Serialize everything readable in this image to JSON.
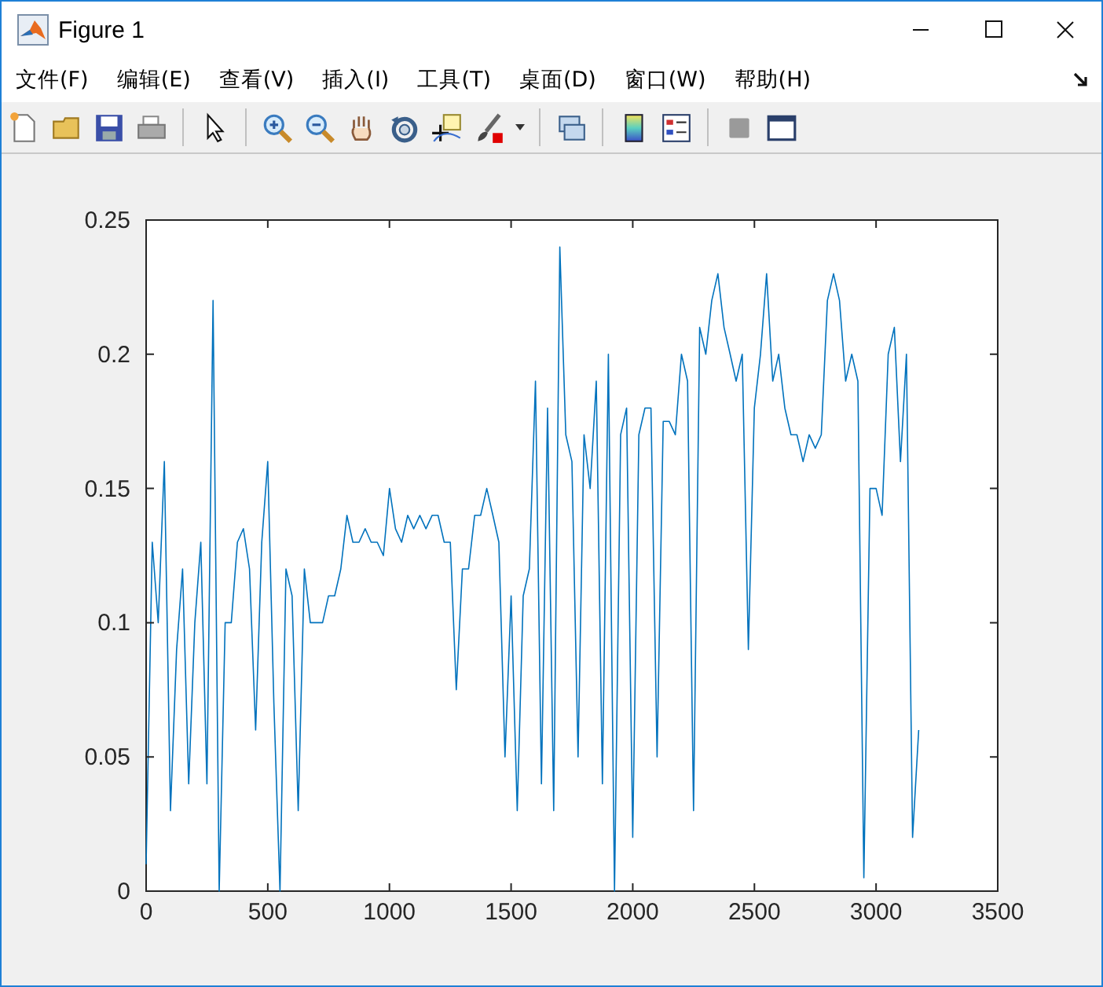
{
  "window": {
    "title": "Figure 1"
  },
  "menu": [
    {
      "label": "文件(F)"
    },
    {
      "label": "编辑(E)"
    },
    {
      "label": "查看(V)"
    },
    {
      "label": "插入(I)"
    },
    {
      "label": "工具(T)"
    },
    {
      "label": "桌面(D)"
    },
    {
      "label": "窗口(W)"
    },
    {
      "label": "帮助(H)"
    }
  ],
  "plot": {
    "chart_data": {
      "type": "line",
      "xlim": [
        0,
        3500
      ],
      "ylim": [
        0,
        0.25
      ],
      "xticks": [
        0,
        500,
        1000,
        1500,
        2000,
        2500,
        3000,
        3500
      ],
      "yticks": [
        {
          "value": 0,
          "label": "0"
        },
        {
          "value": 0.05,
          "label": "0.05"
        },
        {
          "value": 0.1,
          "label": "0.1"
        },
        {
          "value": 0.15,
          "label": "0.15"
        },
        {
          "value": 0.2,
          "label": "0.2"
        },
        {
          "value": 0.25,
          "label": "0.25"
        }
      ],
      "x": [
        0,
        25,
        50,
        75,
        100,
        125,
        150,
        175,
        200,
        225,
        250,
        275,
        300,
        325,
        350,
        375,
        400,
        425,
        450,
        475,
        500,
        525,
        550,
        575,
        600,
        625,
        650,
        675,
        700,
        725,
        750,
        775,
        800,
        825,
        850,
        875,
        900,
        925,
        950,
        975,
        1000,
        1025,
        1050,
        1075,
        1100,
        1125,
        1150,
        1175,
        1200,
        1225,
        1250,
        1275,
        1300,
        1325,
        1350,
        1375,
        1400,
        1425,
        1450,
        1475,
        1500,
        1525,
        1550,
        1575,
        1600,
        1625,
        1650,
        1675,
        1700,
        1725,
        1750,
        1775,
        1800,
        1825,
        1850,
        1875,
        1900,
        1925,
        1950,
        1975,
        2000,
        2025,
        2050,
        2075,
        2100,
        2125,
        2150,
        2175,
        2200,
        2225,
        2250,
        2275,
        2300,
        2325,
        2350,
        2375,
        2400,
        2425,
        2450,
        2475,
        2500,
        2525,
        2550,
        2575,
        2600,
        2625,
        2650,
        2675,
        2700,
        2725,
        2750,
        2775,
        2800,
        2825,
        2850,
        2875,
        2900,
        2925,
        2950,
        2975,
        3000,
        3025,
        3050,
        3075,
        3100,
        3125,
        3150,
        3175
      ],
      "series": [
        {
          "color": "#0072bd",
          "values": [
            0.01,
            0.13,
            0.1,
            0.16,
            0.03,
            0.09,
            0.12,
            0.04,
            0.1,
            0.13,
            0.04,
            0.22,
            0.0,
            0.1,
            0.1,
            0.13,
            0.135,
            0.12,
            0.06,
            0.13,
            0.16,
            0.07,
            0.0,
            0.12,
            0.11,
            0.03,
            0.12,
            0.1,
            0.1,
            0.1,
            0.11,
            0.11,
            0.12,
            0.14,
            0.13,
            0.13,
            0.135,
            0.13,
            0.13,
            0.125,
            0.15,
            0.135,
            0.13,
            0.14,
            0.135,
            0.14,
            0.135,
            0.14,
            0.14,
            0.13,
            0.13,
            0.075,
            0.12,
            0.12,
            0.14,
            0.14,
            0.15,
            0.14,
            0.13,
            0.05,
            0.11,
            0.03,
            0.11,
            0.12,
            0.19,
            0.04,
            0.18,
            0.03,
            0.24,
            0.17,
            0.16,
            0.05,
            0.17,
            0.15,
            0.19,
            0.04,
            0.2,
            0.0,
            0.17,
            0.18,
            0.02,
            0.17,
            0.18,
            0.18,
            0.05,
            0.175,
            0.175,
            0.17,
            0.2,
            0.19,
            0.03,
            0.21,
            0.2,
            0.22,
            0.23,
            0.21,
            0.2,
            0.19,
            0.2,
            0.09,
            0.18,
            0.2,
            0.23,
            0.19,
            0.2,
            0.18,
            0.17,
            0.17,
            0.16,
            0.17,
            0.165,
            0.17,
            0.22,
            0.23,
            0.22,
            0.19,
            0.2,
            0.19,
            0.005,
            0.15,
            0.15,
            0.14,
            0.2,
            0.21,
            0.16,
            0.2,
            0.02,
            0.06
          ]
        }
      ]
    }
  }
}
